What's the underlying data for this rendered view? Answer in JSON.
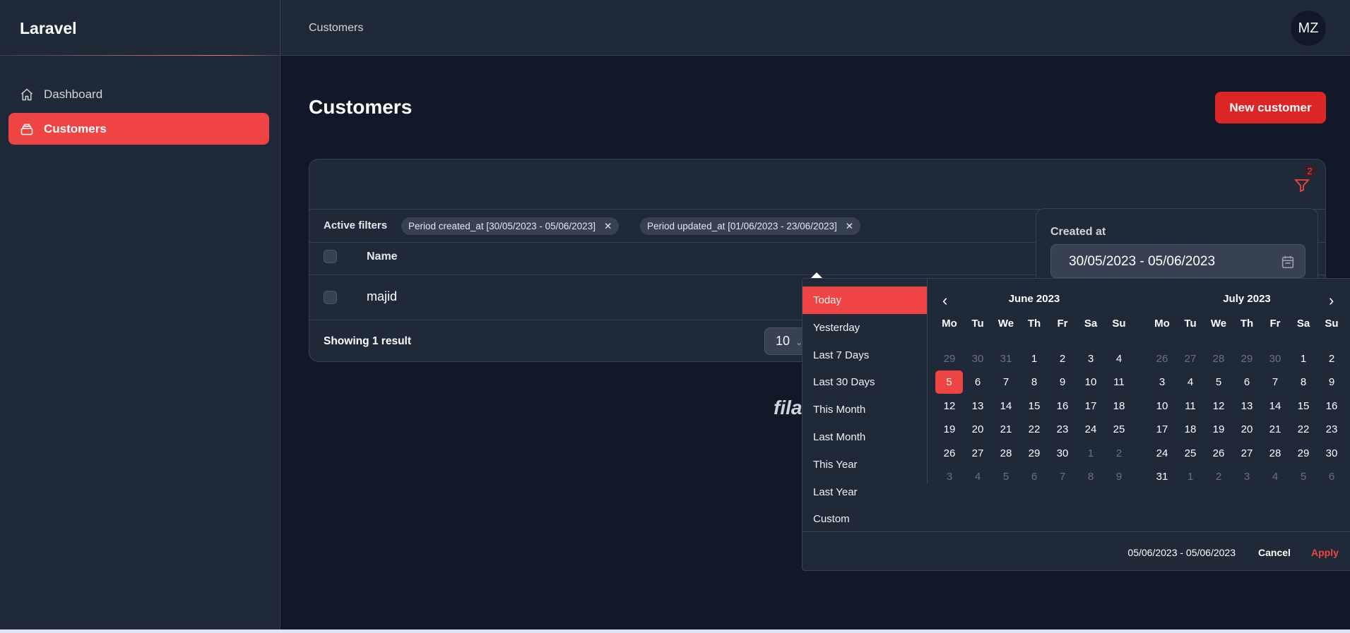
{
  "app": {
    "logo": "Laravel",
    "breadcrumb": "Customers",
    "avatar_initials": "MZ",
    "footer_logo": "filament"
  },
  "sidebar": {
    "items": [
      {
        "label": "Dashboard",
        "icon": "home-icon"
      },
      {
        "label": "Customers",
        "icon": "archive-icon",
        "active": true
      }
    ]
  },
  "page": {
    "title": "Customers",
    "new_button": "New customer"
  },
  "table": {
    "filter_count": "2",
    "active_filters_label": "Active filters",
    "chips": [
      "Period created_at [30/05/2023 - 05/06/2023]",
      "Period updated_at [01/06/2023 - 23/06/2023]"
    ],
    "columns": [
      "Name"
    ],
    "rows": [
      {
        "name": "majid"
      }
    ],
    "summary": "Showing 1 result",
    "per_page": "10"
  },
  "filter_panel": {
    "label": "Created at",
    "value": "30/05/2023 - 05/06/2023"
  },
  "picker": {
    "ranges": [
      "Today",
      "Yesterday",
      "Last 7 Days",
      "Last 30 Days",
      "This Month",
      "Last Month",
      "This Year",
      "Last Year",
      "Custom"
    ],
    "active_range": "Today",
    "weekdays": [
      "Mo",
      "Tu",
      "We",
      "Th",
      "Fr",
      "Sa",
      "Su"
    ],
    "months": [
      {
        "title": "June 2023",
        "first_day": "29",
        "first_month_days": 31,
        "days_in_month": 30,
        "selected": "5"
      },
      {
        "title": "July 2023",
        "first_day": "26",
        "first_month_days": 30,
        "days_in_month": 31,
        "selected": null
      }
    ],
    "selection": "05/06/2023 - 05/06/2023",
    "cancel": "Cancel",
    "apply": "Apply"
  },
  "colors": {
    "accent": "#ef4444",
    "bg": "#111827",
    "surface": "#1f2937",
    "border": "#374151"
  }
}
